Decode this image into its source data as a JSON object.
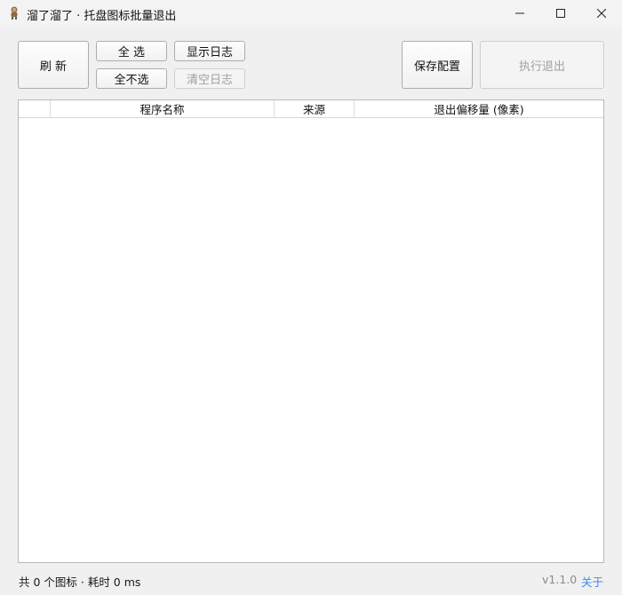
{
  "window": {
    "title": "溜了溜了 · 托盘图标批量退出",
    "icon": "app-figure-icon",
    "controls": [
      "minimize-icon",
      "maximize-icon",
      "close-icon"
    ]
  },
  "toolbar": {
    "refresh_label": "刷 新",
    "select_all_label": "全 选",
    "select_none_label": "全不选",
    "show_log_label": "显示日志",
    "clear_log_label": "清空日志",
    "save_config_label": "保存配置",
    "execute_exit_label": "执行退出"
  },
  "table": {
    "columns": [
      "",
      "程序名称",
      "来源",
      "退出偏移量 (像素)"
    ],
    "rows": []
  },
  "status": {
    "summary": "共 0 个图标 · 耗时 0 ms",
    "version": "v1.1.0",
    "about_label": "关于"
  },
  "colors": {
    "link": "#3b8be8",
    "disabled_text": "#a0a0a0"
  }
}
